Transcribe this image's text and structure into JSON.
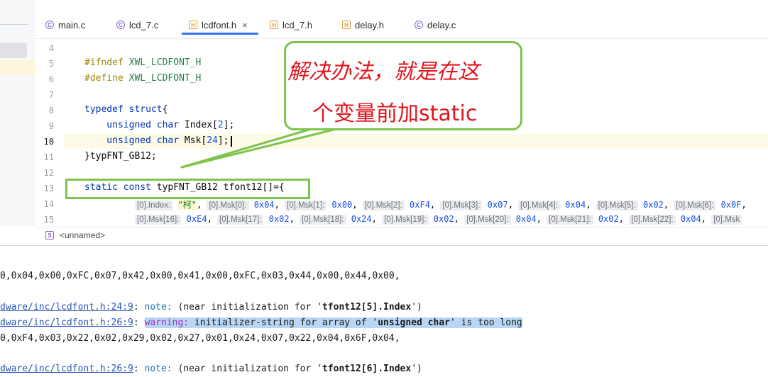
{
  "tabs": [
    {
      "label": "main.c",
      "type": "c"
    },
    {
      "label": "lcd_7.c",
      "type": "c"
    },
    {
      "label": "lcdfont.h",
      "type": "h",
      "active": true,
      "close": "×"
    },
    {
      "label": "lcd_7.h",
      "type": "h"
    },
    {
      "label": "delay.h",
      "type": "h"
    },
    {
      "label": "delay.c",
      "type": "c"
    }
  ],
  "editor": {
    "line_numbers": [
      "4",
      "5",
      "6",
      "7",
      "8",
      "9",
      "10",
      "11",
      "12",
      "13",
      "14",
      "15"
    ],
    "lines": {
      "l5a": "#ifndef",
      "l5b": " XWL_LCDFONT_H",
      "l6a": "#define",
      "l6b": " XWL_LCDFONT_H",
      "l8a": "typedef",
      "l8b": " ",
      "l8c": "struct",
      "l8d": "{",
      "l9a": "    unsigned char",
      "l9b": " Index[",
      "l9c": "2",
      "l9d": "];",
      "l10a": "    unsigned char",
      "l10b": " Msk[",
      "l10c": "24",
      "l10d": "];",
      "l11": "}typFNT_GB12;",
      "l13a": "static const",
      "l13b": " typFNT_GB12 tfont12[]={"
    },
    "hints14": [
      {
        "label": "[0].Index:",
        "value": "\"柯\"",
        "kind": "chr"
      },
      {
        "label": "[0].Msk[0]:",
        "value": "0x04"
      },
      {
        "label": "[0].Msk[1]:",
        "value": "0x00"
      },
      {
        "label": "[0].Msk[2]:",
        "value": "0xF4"
      },
      {
        "label": "[0].Msk[3]:",
        "value": "0x07"
      },
      {
        "label": "[0].Msk[4]:",
        "value": "0x04"
      },
      {
        "label": "[0].Msk[5]:",
        "value": "0x02"
      },
      {
        "label": "[0].Msk[6]:",
        "value": "0x0F"
      }
    ],
    "hints15": [
      {
        "label": "[0].Msk[16]:",
        "value": "0xE4"
      },
      {
        "label": "[0].Msk[17]:",
        "value": "0x02"
      },
      {
        "label": "[0].Msk[18]:",
        "value": "0x24"
      },
      {
        "label": "[0].Msk[19]:",
        "value": "0x02"
      },
      {
        "label": "[0].Msk[20]:",
        "value": "0x04"
      },
      {
        "label": "[0].Msk[21]:",
        "value": "0x02"
      },
      {
        "label": "[0].Msk[22]:",
        "value": "0x04"
      },
      {
        "label": "[0].Msk",
        "value": ""
      }
    ]
  },
  "breadcrumb": {
    "text": "<unnamed>"
  },
  "console": {
    "c1": "0,0x04,0x00,0xFC,0x07,0x42,0x00,0x41,0x00,0xFC,0x03,0x44,0x00,0x44,0x00,",
    "c2_link": "dware/inc/lcdfont.h:24:9",
    "c2_colon": ": ",
    "c2_kind": "note:",
    "c2_msg_a": " (near initialization for '",
    "c2_msg_b": "tfont12[5].Index",
    "c2_msg_c": "')",
    "c3_link": "dware/inc/lcdfont.h:26:9",
    "c3_colon": ": ",
    "c3_kind": "warning:",
    "c3_msg_a": " initializer-string for array of '",
    "c3_msg_b": "unsigned char",
    "c3_msg_c": "' is too long",
    "c4": "0,0xF4,0x03,0x22,0x02,0x29,0x02,0x27,0x01,0x24,0x07,0x22,0x04,0x6F,0x04,",
    "c5_link": "dware/inc/lcdfont.h:26:9",
    "c5_colon": ": ",
    "c5_kind": "note:",
    "c5_msg_a": " (near initialization for '",
    "c5_msg_b": "tfont12[6].Index",
    "c5_msg_c": "')"
  },
  "callout": {
    "line1": "解决办法，就是在这",
    "line2": "个变量前加static",
    "color": "#e0161e",
    "border_color": "#7ec34a"
  },
  "colors": {
    "keyword": "#0033b3",
    "number": "#1750eb",
    "accent": "#3574f0"
  }
}
